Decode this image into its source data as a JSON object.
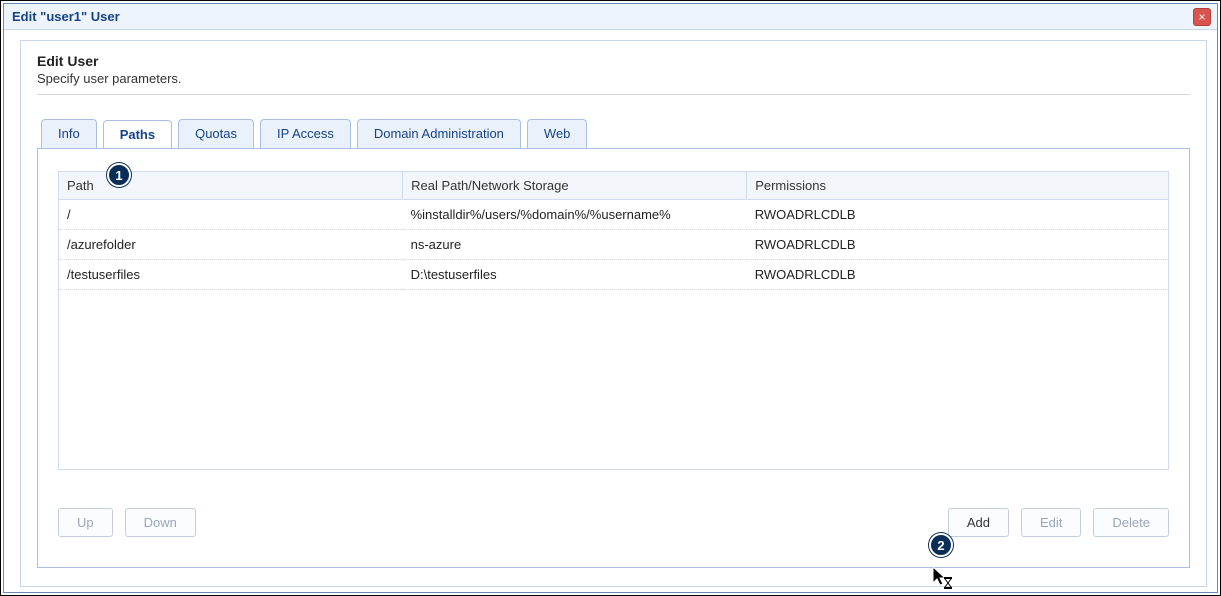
{
  "window": {
    "title": "Edit \"user1\" User",
    "close_label": "×"
  },
  "header": {
    "title": "Edit User",
    "subtitle": "Specify user parameters."
  },
  "tabs": [
    {
      "label": "Info"
    },
    {
      "label": "Paths"
    },
    {
      "label": "Quotas"
    },
    {
      "label": "IP Access"
    },
    {
      "label": "Domain Administration"
    },
    {
      "label": "Web"
    }
  ],
  "active_tab_index": 1,
  "paths_table": {
    "columns": [
      "Path",
      "Real Path/Network Storage",
      "Permissions"
    ],
    "rows": [
      {
        "path": "/",
        "real": "%installdir%/users/%domain%/%username%",
        "perm": "RWOADRLCDLB"
      },
      {
        "path": "/azurefolder",
        "real": "ns-azure",
        "perm": "RWOADRLCDLB"
      },
      {
        "path": "/testuserfiles",
        "real": "D:\\testuserfiles",
        "perm": "RWOADRLCDLB"
      }
    ]
  },
  "buttons": {
    "up": "Up",
    "down": "Down",
    "add": "Add",
    "edit": "Edit",
    "delete": "Delete"
  },
  "callouts": {
    "one": "1",
    "two": "2"
  }
}
